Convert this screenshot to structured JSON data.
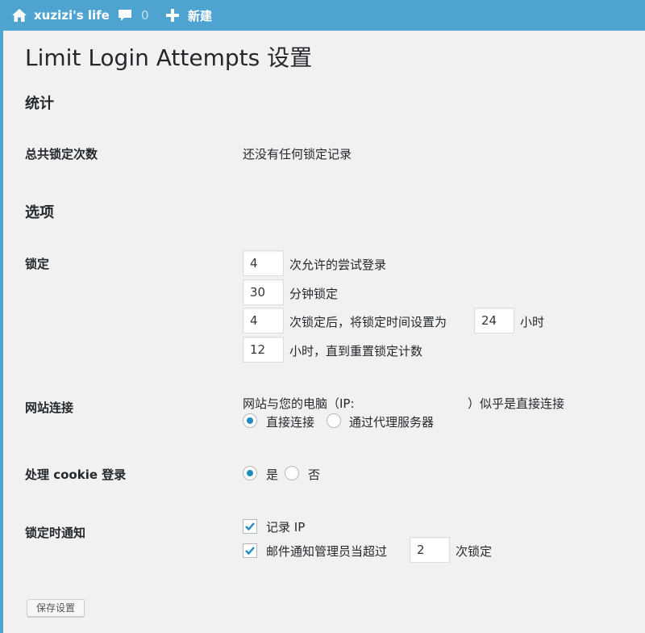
{
  "adminbar": {
    "site_name": "xuzizi's life",
    "comments_count": "0",
    "new_label": "新建",
    "icons": [
      "home-icon",
      "comment-icon",
      "plus-icon"
    ]
  },
  "page": {
    "title": "Limit Login Attempts 设置"
  },
  "stats": {
    "heading": "统计",
    "total_lockouts_label": "总共锁定次数",
    "total_lockouts_value": "还没有任何锁定记录"
  },
  "options": {
    "heading": "选项",
    "lockout": {
      "label": "锁定",
      "allowed_retries": "4",
      "allowed_retries_text": "次允许的尝试登录",
      "lockout_duration": "30",
      "lockout_duration_text": "分钟锁定",
      "allowed_lockouts": "4",
      "allowed_lockouts_text": "次锁定后，将锁定时间设置为",
      "long_duration": "24",
      "long_duration_text": "小时",
      "valid_duration": "12",
      "valid_duration_text": "小时，直到重置锁定计数"
    },
    "site_connection": {
      "label": "网站连接",
      "description_prefix": "网站与您的电脑（IP:",
      "description_suffix": "）似乎是直接连接",
      "option_direct": "直接连接",
      "option_proxy": "通过代理服务器",
      "selected": "直接连接"
    },
    "cookie_login": {
      "label": "处理 cookie 登录",
      "option_yes": "是",
      "option_no": "否",
      "selected": "是"
    },
    "notify": {
      "label": "锁定时通知",
      "log_ip_text": "记录 IP",
      "log_ip_checked": true,
      "email_text": "邮件通知管理员当超过",
      "email_after": "2",
      "email_suffix": "次锁定",
      "email_checked": true
    }
  },
  "save_button": "保存设置",
  "colors": {
    "adminbar": "#4ea3d0",
    "accent": "#1e8cbe",
    "background": "#f1f1f1"
  }
}
